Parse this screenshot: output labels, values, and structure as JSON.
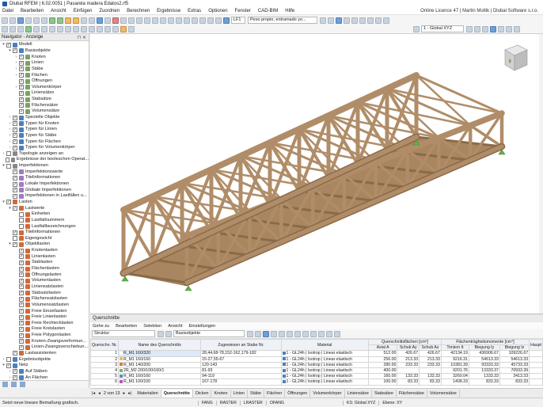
{
  "window": {
    "title": "Dlubal RFEM | 6.02.0051 | Pasarela madera Edatos2.rf5"
  },
  "menu": [
    "Datei",
    "Bearbeiten",
    "Ansicht",
    "Einfügen",
    "Zuordnen",
    "Berechnen",
    "Ergebnisse",
    "Extras",
    "Optionen",
    "Fenster",
    "CAD-BIM",
    "Hilfe"
  ],
  "licence": "Online Licence 47 | Martin Motlik | Dlubal Software s.r.o.",
  "toolbar": {
    "lc_code": "LF1",
    "lc_name": "Peso propio, entramado yo...",
    "view_combo": "1 - Global XYZ"
  },
  "navigator": {
    "title": "Navigator - Anzeige",
    "items": [
      {
        "label": "Modell",
        "level": 0,
        "exp": "▾",
        "cb": "✓",
        "color": "#4a7fc0"
      },
      {
        "label": "Basisobjekte",
        "level": 1,
        "exp": "▾",
        "cb": "✓",
        "color": "#4a7fc0"
      },
      {
        "label": "Knoten",
        "level": 2,
        "exp": "›",
        "cb": "✓",
        "color": "#7aa260"
      },
      {
        "label": "Linien",
        "level": 2,
        "exp": "›",
        "cb": "✓",
        "color": "#7aa260"
      },
      {
        "label": "Stäbe",
        "level": 2,
        "exp": "›",
        "cb": "✓",
        "color": "#7aa260"
      },
      {
        "label": "Flächen",
        "level": 2,
        "exp": "›",
        "cb": "✓",
        "color": "#7aa260"
      },
      {
        "label": "Öffnungen",
        "level": 2,
        "exp": "",
        "cb": "✓",
        "color": "#7aa260"
      },
      {
        "label": "Volumenkörper",
        "level": 2,
        "exp": "›",
        "cb": "✓",
        "color": "#7aa260"
      },
      {
        "label": "Liniensätze",
        "level": 2,
        "exp": "",
        "cb": "✓",
        "color": "#7aa260"
      },
      {
        "label": "Stabsätze",
        "level": 2,
        "exp": "",
        "cb": "✓",
        "color": "#7aa260"
      },
      {
        "label": "Flächensätze",
        "level": 2,
        "exp": "",
        "cb": "✓",
        "color": "#7aa260"
      },
      {
        "label": "Volumensätze",
        "level": 2,
        "exp": "",
        "cb": "✓",
        "color": "#7aa260"
      },
      {
        "label": "Spezielle Objekte",
        "level": 1,
        "exp": "›",
        "cb": "✓",
        "color": "#4a7fc0"
      },
      {
        "label": "Typen für Knoten",
        "level": 1,
        "exp": "›",
        "cb": "✓",
        "color": "#4a7fc0"
      },
      {
        "label": "Typen für Linien",
        "level": 1,
        "exp": "›",
        "cb": "✓",
        "color": "#4a7fc0"
      },
      {
        "label": "Typen für Stäbe",
        "level": 1,
        "exp": "›",
        "cb": "✓",
        "color": "#4a7fc0"
      },
      {
        "label": "Typen für Flächen",
        "level": 1,
        "exp": "›",
        "cb": "✓",
        "color": "#4a7fc0"
      },
      {
        "label": "Typen für Volumenkörper",
        "level": 1,
        "exp": "›",
        "cb": "✓",
        "color": "#4a7fc0"
      },
      {
        "label": "Topologie anzeigen an",
        "level": 0,
        "exp": "›",
        "cb": "",
        "color": "#888888"
      },
      {
        "label": "Ergebnisse der booleschen Operat...",
        "level": 0,
        "exp": "",
        "cb": "",
        "color": "#888888"
      },
      {
        "label": "Imperfektionen",
        "level": 0,
        "exp": "▾",
        "cb": "",
        "color": "#888888"
      },
      {
        "label": "Imperfektionswerte",
        "level": 1,
        "exp": "",
        "cb": "✓",
        "color": "#a07ac0"
      },
      {
        "label": "Titelinformationen",
        "level": 1,
        "exp": "",
        "cb": "✓",
        "color": "#a07ac0"
      },
      {
        "label": "Lokale Imperfektionen",
        "level": 1,
        "exp": "",
        "cb": "✓",
        "color": "#a07ac0"
      },
      {
        "label": "Globale Imperfektionen",
        "level": 1,
        "exp": "",
        "cb": "✓",
        "color": "#a07ac0"
      },
      {
        "label": "Imperfektionen in Lastfällen u...",
        "level": 1,
        "exp": "",
        "cb": "✓",
        "color": "#a07ac0"
      },
      {
        "label": "Lasten",
        "level": 0,
        "exp": "▾",
        "cb": "✓",
        "color": "#d06a3a"
      },
      {
        "label": "Lastwerte",
        "level": 1,
        "exp": "▾",
        "cb": "✓",
        "color": "#d06a3a"
      },
      {
        "label": "Einheiten",
        "level": 2,
        "exp": "",
        "cb": "",
        "color": "#d06a3a"
      },
      {
        "label": "Lastfallnummern",
        "level": 2,
        "exp": "",
        "cb": "",
        "color": "#d06a3a"
      },
      {
        "label": "Lastfallbezeichnungen",
        "level": 2,
        "exp": "",
        "cb": "",
        "color": "#d06a3a"
      },
      {
        "label": "Titelinformationen",
        "level": 1,
        "exp": "",
        "cb": "✓",
        "color": "#d06a3a"
      },
      {
        "label": "Eigengewicht",
        "level": 1,
        "exp": "",
        "cb": "",
        "color": "#d06a3a"
      },
      {
        "label": "Objektlasten",
        "level": 1,
        "exp": "▾",
        "cb": "✓",
        "color": "#d06a3a"
      },
      {
        "label": "Knotenlasten",
        "level": 2,
        "exp": "",
        "cb": "✓",
        "color": "#d06a3a"
      },
      {
        "label": "Linienlasten",
        "level": 2,
        "exp": "",
        "cb": "✓",
        "color": "#d06a3a"
      },
      {
        "label": "Stablasten",
        "level": 2,
        "exp": "",
        "cb": "✓",
        "color": "#d06a3a"
      },
      {
        "label": "Flächenlasten",
        "level": 2,
        "exp": "",
        "cb": "✓",
        "color": "#d06a3a"
      },
      {
        "label": "Öffnungslasten",
        "level": 2,
        "exp": "",
        "cb": "✓",
        "color": "#d06a3a"
      },
      {
        "label": "Volumenlasten",
        "level": 2,
        "exp": "",
        "cb": "✓",
        "color": "#d06a3a"
      },
      {
        "label": "Liniensatzlasten",
        "level": 2,
        "exp": "",
        "cb": "✓",
        "color": "#d06a3a"
      },
      {
        "label": "Stabsatzlasten",
        "level": 2,
        "exp": "",
        "cb": "✓",
        "color": "#d06a3a"
      },
      {
        "label": "Flächensatzlasten",
        "level": 2,
        "exp": "",
        "cb": "✓",
        "color": "#d06a3a"
      },
      {
        "label": "Volumensatzlasten",
        "level": 2,
        "exp": "",
        "cb": "✓",
        "color": "#d06a3a"
      },
      {
        "label": "Freie Einzellasten",
        "level": 2,
        "exp": "",
        "cb": "✓",
        "color": "#d06a3a"
      },
      {
        "label": "Freie Linienlasten",
        "level": 2,
        "exp": "",
        "cb": "✓",
        "color": "#d06a3a"
      },
      {
        "label": "Freie Rechtecklasten",
        "level": 2,
        "exp": "",
        "cb": "✓",
        "color": "#d06a3a"
      },
      {
        "label": "Freie Kreislasten",
        "level": 2,
        "exp": "",
        "cb": "✓",
        "color": "#d06a3a"
      },
      {
        "label": "Freie Polygonlasten",
        "level": 2,
        "exp": "",
        "cb": "✓",
        "color": "#d06a3a"
      },
      {
        "label": "Knoten-Zwangsverformun...",
        "level": 2,
        "exp": "",
        "cb": "✓",
        "color": "#d06a3a"
      },
      {
        "label": "Linien-Zwangsverschiebun...",
        "level": 2,
        "exp": "",
        "cb": "✓",
        "color": "#d06a3a"
      },
      {
        "label": "Lastassistenten",
        "level": 1,
        "exp": "",
        "cb": "✓",
        "color": "#d06a3a"
      },
      {
        "label": "Ergebnisobjekte",
        "level": 0,
        "exp": "›",
        "cb": "",
        "color": "#4a7fc0"
      },
      {
        "label": "Netz",
        "level": 0,
        "exp": "▾",
        "cb": "✓",
        "color": "#4a7fc0"
      },
      {
        "label": "Auf Stäben",
        "level": 1,
        "exp": "›",
        "cb": "✓",
        "color": "#4a7fc0"
      },
      {
        "label": "An Flächen",
        "level": 1,
        "exp": "›",
        "cb": "✓",
        "color": "#4a7fc0"
      }
    ]
  },
  "panel": {
    "title": "Querschnitte",
    "menu": [
      "Gehe zu",
      "Bearbeiten",
      "Selektion",
      "Ansicht",
      "Einstellungen"
    ],
    "filter": "Struktur",
    "category": "Basisobjekte",
    "headers": {
      "no": "Querschn. Nr.",
      "name": "Name des Querschnitts",
      "assigned": "Zugewiesen an Stabe Nr.",
      "material": "Material",
      "area_group": "Querschnittsflächen [cm²]",
      "area_a": "Axial A",
      "area_ay": "Schub Ay",
      "area_az": "Schub Az",
      "moment_group": "Flächenträgheitsmomente [cm⁴]",
      "it": "Torsion It",
      "iy": "Biegung Iy",
      "iz": "Biegung Iz",
      "main": "Haupt"
    },
    "rows": [
      {
        "no": "1",
        "color": "#ffffff",
        "name": "R_M1 160/320",
        "assigned": "28,44,68-78,152-162,179-182",
        "material": "1 - GL24h | Isotrop | Linear elastisch",
        "a": "512.00",
        "ay": "426.67",
        "az": "426.67",
        "it": "42134.19",
        "iy": "436906.67",
        "iz": "109226.67"
      },
      {
        "no": "2",
        "color": "#e8c060",
        "name": "R_M1 160/160",
        "assigned": "15-27,55-67",
        "material": "1 - GL24h | Isotrop | Linear elastisch",
        "a": "256.00",
        "ay": "213.33",
        "az": "213.33",
        "it": "9216.31",
        "iy": "54613.33",
        "iz": "54613.33"
      },
      {
        "no": "3",
        "color": "#e07a3c",
        "name": "R_M1 140/200",
        "assigned": "120-143",
        "material": "1 - GL24h | Isotrop | Linear elastisch",
        "a": "280.00",
        "ay": "233.33",
        "az": "233.33",
        "it": "10381.39",
        "iy": "93333.33",
        "iz": "45733.33"
      },
      {
        "no": "4",
        "color": "#88b060",
        "name": "2R_M2 200/100/160/1",
        "assigned": "81-93",
        "material": "1 - GL24h | Isotrop | Linear elastisch",
        "a": "400.00",
        "ay": "",
        "az": "",
        "it": "9201.76",
        "iy": "13333.37",
        "iz": "70933.39"
      },
      {
        "no": "5",
        "color": "#5a88c8",
        "name": "R_M1 160/160",
        "assigned": "94-119",
        "material": "1 - GL24h | Isotrop | Linear elastisch",
        "a": "160.00",
        "ay": "133.33",
        "az": "133.33",
        "it": "3260.04",
        "iy": "1333.33",
        "iz": "3413.33"
      },
      {
        "no": "6",
        "color": "#b05aa8",
        "name": "R_M1 100/100",
        "assigned": "167-178",
        "material": "1 - GL24h | Isotrop | Linear elastisch",
        "a": "100.00",
        "ay": "83.33",
        "az": "83.33",
        "it": "1408.33",
        "iy": "833.33",
        "iz": "833.33"
      }
    ],
    "pager": "2 von 13",
    "tabs": [
      "Materialien",
      "Querschnitte",
      "Dicken",
      "Knoten",
      "Linien",
      "Stäbe",
      "Flächen",
      "Öffnungen",
      "Volumenkörper",
      "Liniensätze",
      "Stabsätze",
      "Flächensätze",
      "Volumensätze"
    ],
    "active_tab": "Querschnitte"
  },
  "status": {
    "message": "Setzt neue lineare Bemaßung grafisch.",
    "flags": [
      "FANG",
      "RASTER",
      "LRASTER",
      "OFANG"
    ],
    "ks": "KS: Global XYZ",
    "ebene": "Ebene: XY"
  },
  "colors": {
    "timber": "#b08d68",
    "timber_dark": "#8a6a4a",
    "support": "#3cc43c"
  }
}
